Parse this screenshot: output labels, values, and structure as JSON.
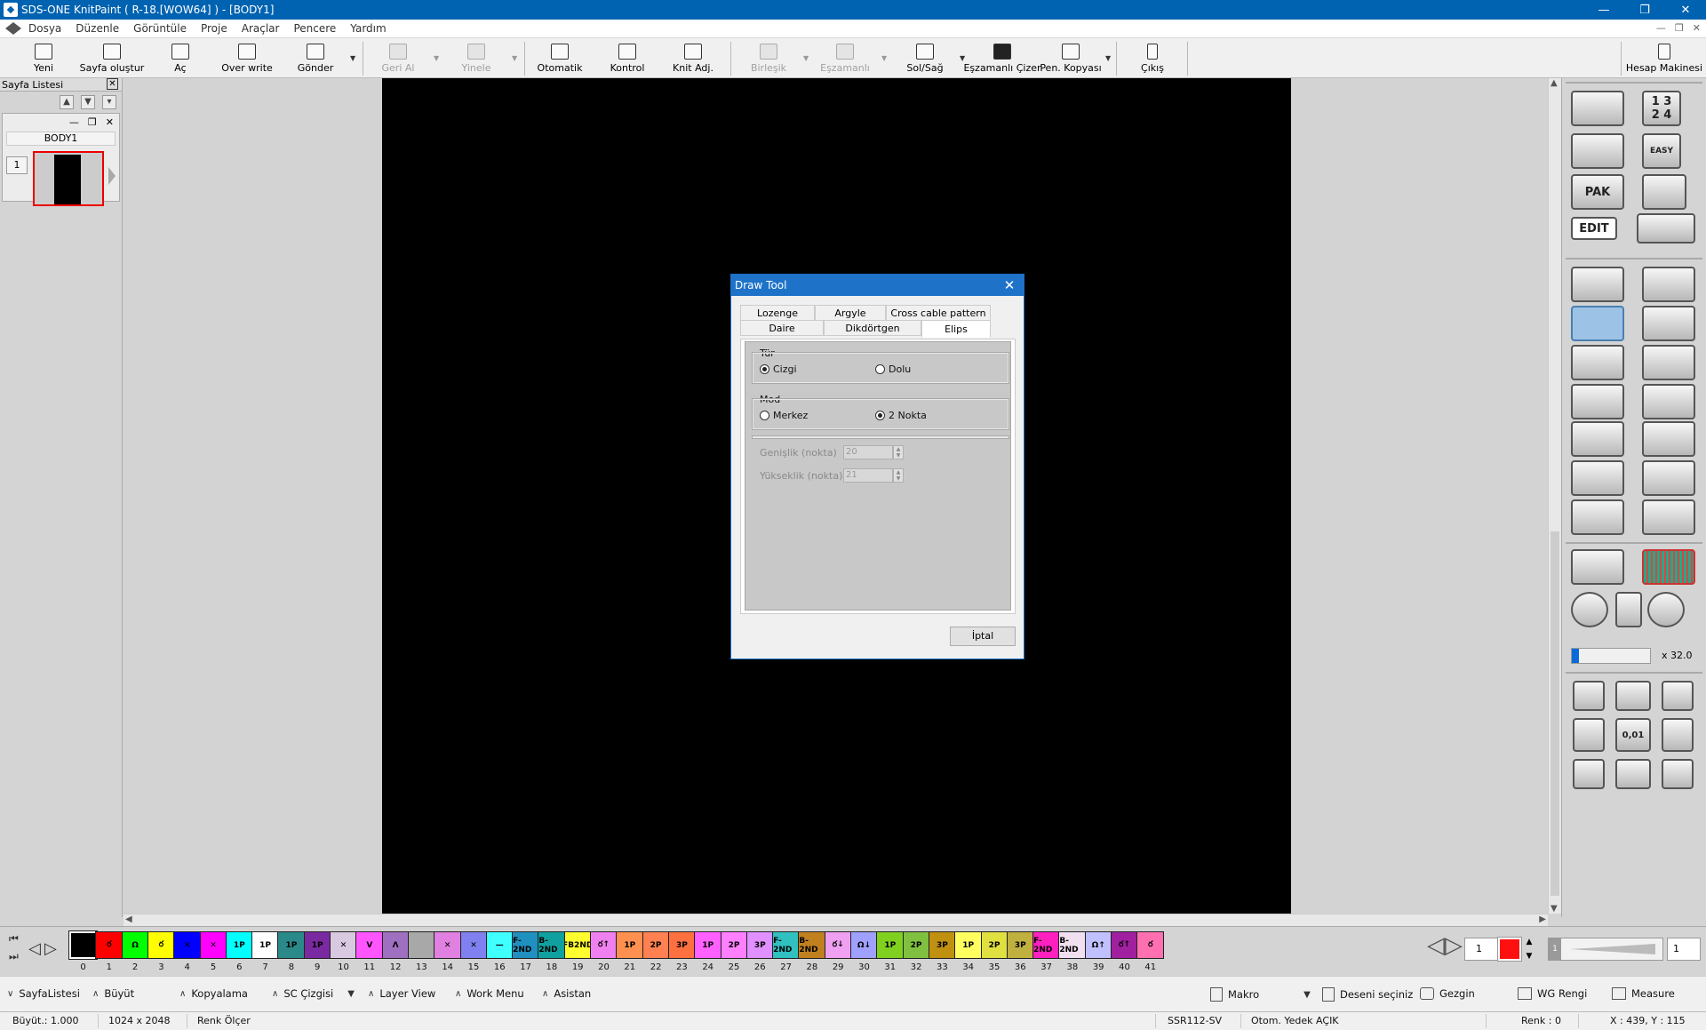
{
  "window": {
    "title": "SDS-ONE KnitPaint ( R-18.[WOW64] ) - [BODY1]",
    "min": "—",
    "max": "❐",
    "close": "✕"
  },
  "menu": [
    "Dosya",
    "Düzenle",
    "Görüntüle",
    "Proje",
    "Araçlar",
    "Pencere",
    "Yardım"
  ],
  "toolbar": {
    "yeni": "Yeni",
    "sayfa": "Sayfa oluştur",
    "ac": "Aç",
    "overwrite": "Over write",
    "gonder": "Gönder",
    "geri": "Geri Al",
    "yinele": "Yinele",
    "otomatik": "Otomatik",
    "kontrol": "Kontrol",
    "knit": "Knit Adj.",
    "birlesik": "Birleşik",
    "eszamanli": "Eşzamanlı",
    "solsag": "Sol/Sağ",
    "eszcizer": "Eşzamanlı Çizer",
    "pen": "Pen. Kopyası",
    "cikis": "Çıkış",
    "hesap": "Hesap Makinesi"
  },
  "side_panel": {
    "title": "Sayfa Listesi",
    "page_name": "BODY1",
    "page_num": "1"
  },
  "right_panel": {
    "edit": "EDIT",
    "pak": "PAK",
    "zoom": "x 32.0"
  },
  "dialog": {
    "title": "Draw Tool",
    "tabs_top": [
      "Lozenge",
      "Argyle",
      "Cross cable pattern"
    ],
    "tabs_bottom": [
      "Daire",
      "Dikdörtgen",
      "Elips"
    ],
    "active_tab": "Elips",
    "tur": {
      "label": "Tür",
      "opt1": "Cizgi",
      "opt2": "Dolu",
      "selected": "Cizgi"
    },
    "mod": {
      "label": "Mod",
      "opt1": "Merkez",
      "opt2": "2 Nokta",
      "selected": "2 Nokta"
    },
    "width": {
      "label": "Genişlik (nokta)",
      "value": "20"
    },
    "height": {
      "label": "Yükseklik (nokta)",
      "value": "21"
    },
    "cancel": "İptal"
  },
  "palette": {
    "swatches": [
      {
        "n": "0",
        "c": "#000000",
        "t": ""
      },
      {
        "n": "1",
        "c": "#ff0000",
        "t": "ర"
      },
      {
        "n": "2",
        "c": "#00ff00",
        "t": "Ω"
      },
      {
        "n": "3",
        "c": "#ffff00",
        "t": "ర"
      },
      {
        "n": "4",
        "c": "#0000ff",
        "t": "✕"
      },
      {
        "n": "5",
        "c": "#ff00ff",
        "t": "✕"
      },
      {
        "n": "6",
        "c": "#00ffff",
        "t": "1P"
      },
      {
        "n": "7",
        "c": "#ffffff",
        "t": "1P"
      },
      {
        "n": "8",
        "c": "#2a8a8a",
        "t": "1P"
      },
      {
        "n": "9",
        "c": "#7a2aa0",
        "t": "1P"
      },
      {
        "n": "10",
        "c": "#d8c8e0",
        "t": "✕"
      },
      {
        "n": "11",
        "c": "#ff55ff",
        "t": "V"
      },
      {
        "n": "12",
        "c": "#a070c0",
        "t": "Λ"
      },
      {
        "n": "13",
        "c": "#a8a8a8",
        "t": ""
      },
      {
        "n": "14",
        "c": "#e080e0",
        "t": "✕"
      },
      {
        "n": "15",
        "c": "#8080f0",
        "t": "✕"
      },
      {
        "n": "16",
        "c": "#40ffff",
        "t": "—"
      },
      {
        "n": "17",
        "c": "#2090c0",
        "t": "F-2ND"
      },
      {
        "n": "18",
        "c": "#10a0a0",
        "t": "B-2ND"
      },
      {
        "n": "19",
        "c": "#ffff30",
        "t": "FB2ND"
      },
      {
        "n": "20",
        "c": "#f080f0",
        "t": "ర↑"
      },
      {
        "n": "21",
        "c": "#ff9050",
        "t": "1P"
      },
      {
        "n": "22",
        "c": "#ff8050",
        "t": "2P"
      },
      {
        "n": "23",
        "c": "#ff7040",
        "t": "3P"
      },
      {
        "n": "24",
        "c": "#ff60ff",
        "t": "1P"
      },
      {
        "n": "25",
        "c": "#ff80ff",
        "t": "2P"
      },
      {
        "n": "26",
        "c": "#e090ff",
        "t": "3P"
      },
      {
        "n": "27",
        "c": "#30c0c0",
        "t": "F-2ND"
      },
      {
        "n": "28",
        "c": "#c08020",
        "t": "B-2ND"
      },
      {
        "n": "29",
        "c": "#f0a0f0",
        "t": "ర↓"
      },
      {
        "n": "30",
        "c": "#a0a0ff",
        "t": "Ω↓"
      },
      {
        "n": "31",
        "c": "#80d020",
        "t": "1P"
      },
      {
        "n": "32",
        "c": "#80c040",
        "t": "2P"
      },
      {
        "n": "33",
        "c": "#c09010",
        "t": "3P"
      },
      {
        "n": "34",
        "c": "#ffff60",
        "t": "1P"
      },
      {
        "n": "35",
        "c": "#e0e040",
        "t": "2P"
      },
      {
        "n": "36",
        "c": "#c0b040",
        "t": "3P"
      },
      {
        "n": "37",
        "c": "#ff20c0",
        "t": "F-2ND"
      },
      {
        "n": "38",
        "c": "#f0e0f0",
        "t": "B-2ND"
      },
      {
        "n": "39",
        "c": "#c0c0ff",
        "t": "Ω↑"
      },
      {
        "n": "40",
        "c": "#a020a0",
        "t": "ర↑"
      },
      {
        "n": "41",
        "c": "#ff70b0",
        "t": "ర"
      }
    ],
    "current": "1",
    "count": "1",
    "slider_tick": "1"
  },
  "bottombar": {
    "sayfalistesi": "SayfaListesi",
    "buyut": "Büyüt",
    "kopyalama": "Kopyalama",
    "sc": "SC Çizgisi",
    "layer": "Layer View",
    "work": "Work Menu",
    "asistan": "Asistan",
    "makro": "Makro",
    "deseni": "Deseni seçiniz",
    "gezgin": "Gezgin",
    "wg": "WG Rengi",
    "measure": "Measure"
  },
  "status": {
    "buyut": "Büyüt.: 1.000",
    "size": "1024 x 2048",
    "renk": "Renk Ölçer",
    "ssr": "SSR112-SV",
    "yedek": "Otom. Yedek AÇIK",
    "renknum": "Renk :  0",
    "xy": "X : 439, Y : 115"
  }
}
